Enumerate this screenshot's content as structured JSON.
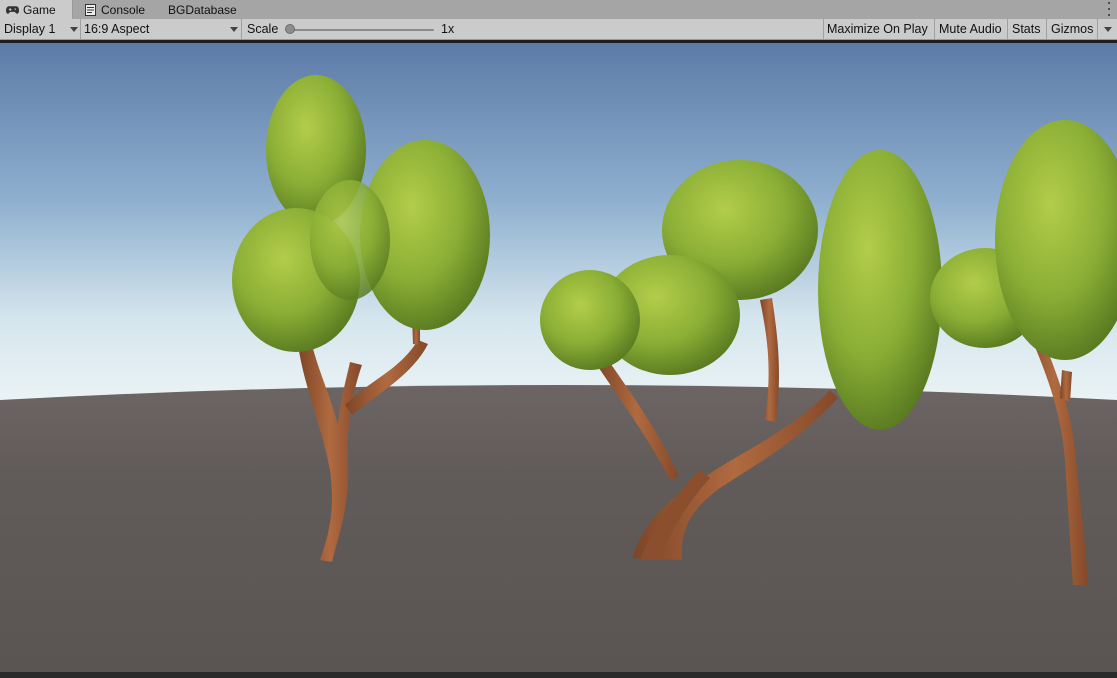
{
  "tabs": [
    {
      "label": "Game",
      "icon": "gamepad-icon",
      "active": true
    },
    {
      "label": "Console",
      "icon": "console-icon",
      "active": false
    },
    {
      "label": "BGDatabase",
      "icon": "",
      "active": false
    }
  ],
  "toolbar": {
    "display_label": "Display 1",
    "aspect_label": "16:9 Aspect",
    "scale_label": "Scale",
    "scale_value": "1x",
    "scale_fraction": 0.0,
    "maximize_label": "Maximize On Play",
    "mute_label": "Mute Audio",
    "stats_label": "Stats",
    "gizmos_label": "Gizmos"
  },
  "scene": {
    "sky_top": "#5a7aa8",
    "sky_horizon": "#e9f3f6",
    "ground": "#5e5856",
    "trunk_color": "#a3603a",
    "foliage_color": "#8fb33a"
  }
}
